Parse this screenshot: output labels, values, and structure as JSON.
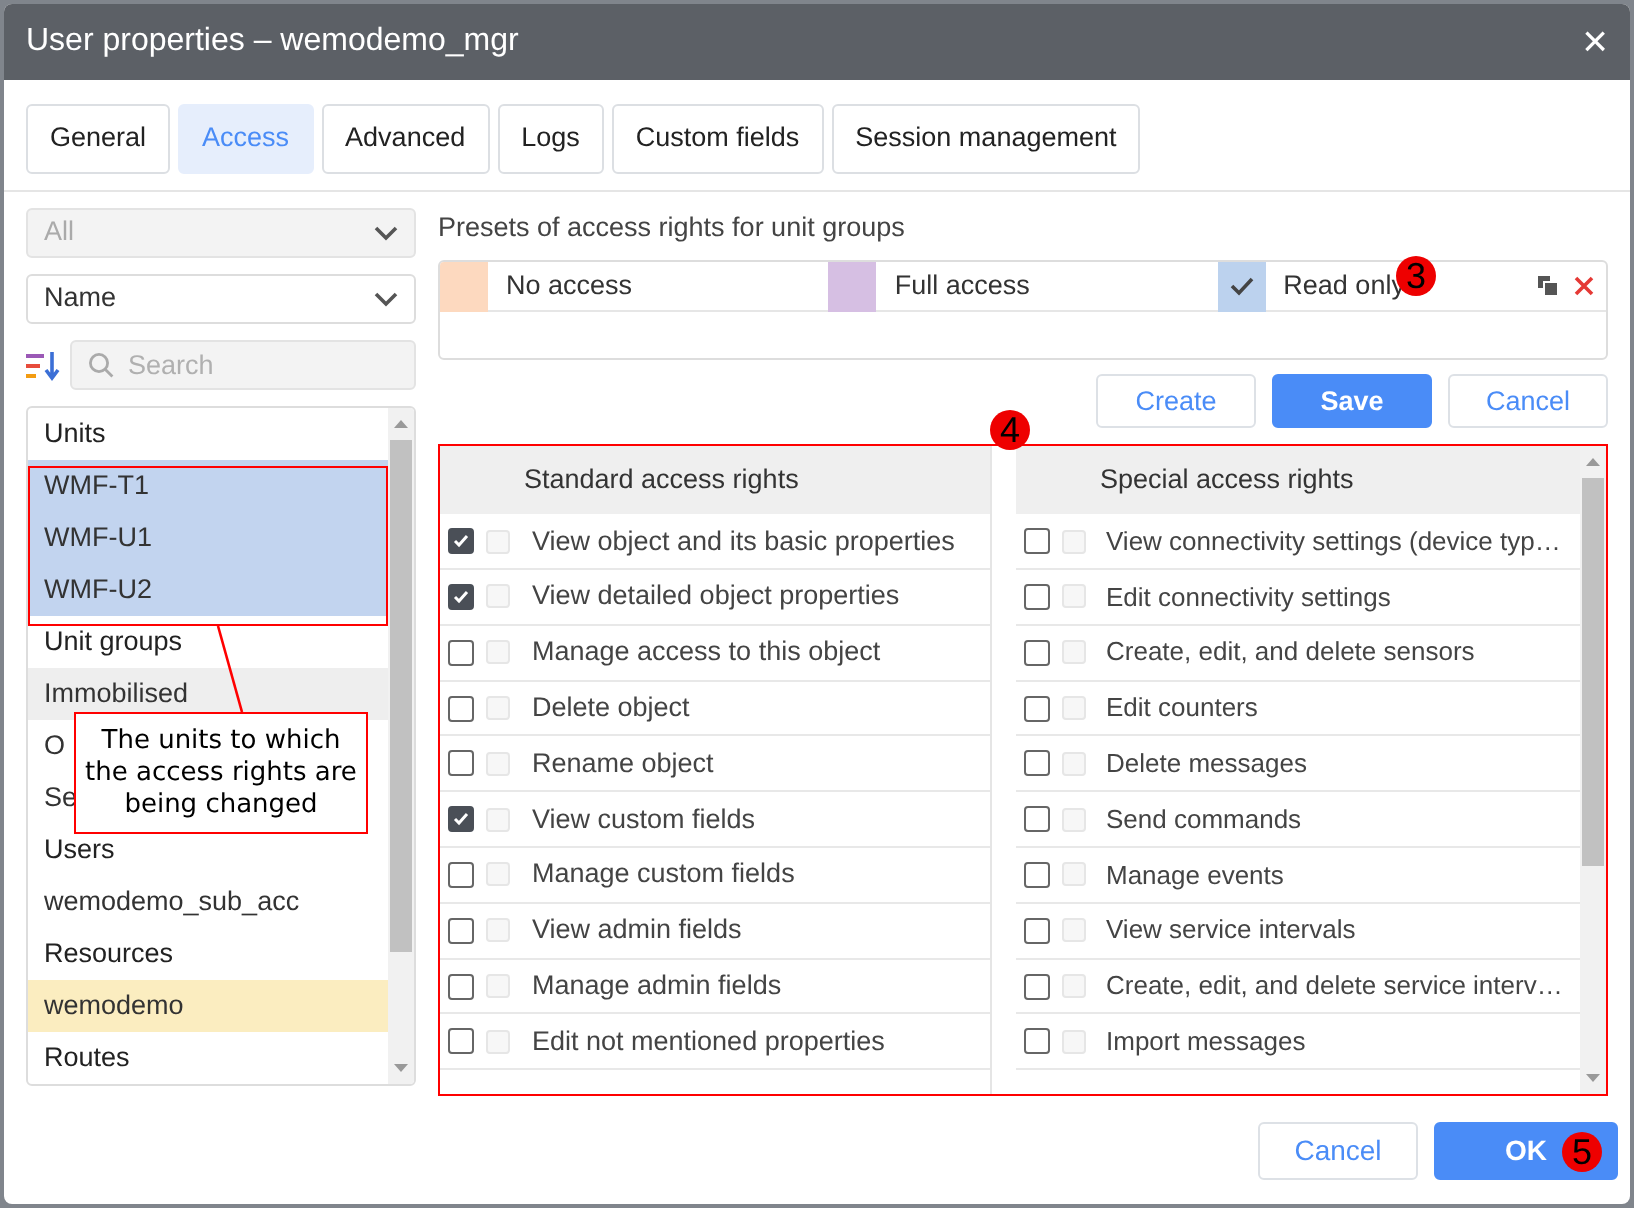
{
  "window": {
    "title": "User properties – wemodemo_mgr",
    "close": "×"
  },
  "tabs": [
    {
      "label": "General",
      "selected": false
    },
    {
      "label": "Access",
      "selected": true
    },
    {
      "label": "Advanced",
      "selected": false
    },
    {
      "label": "Logs",
      "selected": false
    },
    {
      "label": "Custom fields",
      "selected": false
    },
    {
      "label": "Session management",
      "selected": false
    }
  ],
  "filters": {
    "type_select": {
      "value": "All",
      "disabled": true
    },
    "sort_select": {
      "value": "Name",
      "disabled": false
    },
    "search": {
      "placeholder": "Search"
    }
  },
  "object_list": [
    {
      "kind": "header",
      "label": "Units"
    },
    {
      "kind": "item",
      "label": "WMF-T1",
      "selected": true,
      "current": false,
      "hovered": false
    },
    {
      "kind": "item",
      "label": "WMF-U1",
      "selected": true,
      "current": false,
      "hovered": false
    },
    {
      "kind": "item",
      "label": "WMF-U2",
      "selected": true,
      "current": false,
      "hovered": false
    },
    {
      "kind": "header",
      "label": "Unit groups"
    },
    {
      "kind": "item",
      "label": "Immobilised",
      "selected": false,
      "current": false,
      "hovered": true
    },
    {
      "kind": "item",
      "label": "O",
      "selected": false,
      "current": false,
      "hovered": false
    },
    {
      "kind": "item",
      "label": "Se",
      "selected": false,
      "current": false,
      "hovered": false
    },
    {
      "kind": "header",
      "label": "Users"
    },
    {
      "kind": "item",
      "label": "wemodemo_sub_acc",
      "selected": false,
      "current": false,
      "hovered": false
    },
    {
      "kind": "header",
      "label": "Resources"
    },
    {
      "kind": "item",
      "label": "wemodemo",
      "selected": false,
      "current": true,
      "hovered": false
    },
    {
      "kind": "header",
      "label": "Routes"
    }
  ],
  "presets": {
    "label": "Presets of access rights for unit groups",
    "items": [
      {
        "label": "No access",
        "color": "#fdd9bf",
        "selected": false
      },
      {
        "label": "Full access",
        "color": "#d6bfe3",
        "selected": false
      },
      {
        "label": "Read only",
        "color": "#bcd2ee",
        "selected": true
      }
    ],
    "buttons": [
      {
        "label": "Create",
        "kind": "secondary"
      },
      {
        "label": "Save",
        "kind": "primary"
      },
      {
        "label": "Cancel",
        "kind": "secondary"
      }
    ]
  },
  "rights": [
    {
      "title": "Standard access rights",
      "rows": [
        {
          "label": "View object and its basic properties",
          "checked": true,
          "inherited": false
        },
        {
          "label": "View detailed object properties",
          "checked": true,
          "inherited": false
        },
        {
          "label": "Manage access to this object",
          "checked": false,
          "inherited": false
        },
        {
          "label": "Delete object",
          "checked": false,
          "inherited": false
        },
        {
          "label": "Rename object",
          "checked": false,
          "inherited": false
        },
        {
          "label": "View custom fields",
          "checked": true,
          "inherited": false
        },
        {
          "label": "Manage custom fields",
          "checked": false,
          "inherited": false
        },
        {
          "label": "View admin fields",
          "checked": false,
          "inherited": false
        },
        {
          "label": "Manage admin fields",
          "checked": false,
          "inherited": false
        },
        {
          "label": "Edit not mentioned properties",
          "checked": false,
          "inherited": false
        }
      ]
    },
    {
      "title": "Special access rights",
      "rows": [
        {
          "label": "View connectivity settings (device typ…",
          "checked": false,
          "inherited": false
        },
        {
          "label": "Edit connectivity settings",
          "checked": false,
          "inherited": false
        },
        {
          "label": "Create, edit, and delete sensors",
          "checked": false,
          "inherited": false
        },
        {
          "label": "Edit counters",
          "checked": false,
          "inherited": false
        },
        {
          "label": "Delete messages",
          "checked": false,
          "inherited": false
        },
        {
          "label": "Send commands",
          "checked": false,
          "inherited": false
        },
        {
          "label": "Manage events",
          "checked": false,
          "inherited": false
        },
        {
          "label": "View service intervals",
          "checked": false,
          "inherited": false
        },
        {
          "label": "Create, edit, and delete service interv…",
          "checked": false,
          "inherited": false
        },
        {
          "label": "Import messages",
          "checked": false,
          "inherited": false
        }
      ]
    }
  ],
  "footer": {
    "buttons": [
      {
        "label": "Cancel",
        "kind": "secondary"
      },
      {
        "label": "OK",
        "kind": "primary"
      }
    ]
  },
  "annotations": {
    "callout": "The units to which the access rights are being changed",
    "markers": [
      "3",
      "4",
      "5"
    ]
  }
}
